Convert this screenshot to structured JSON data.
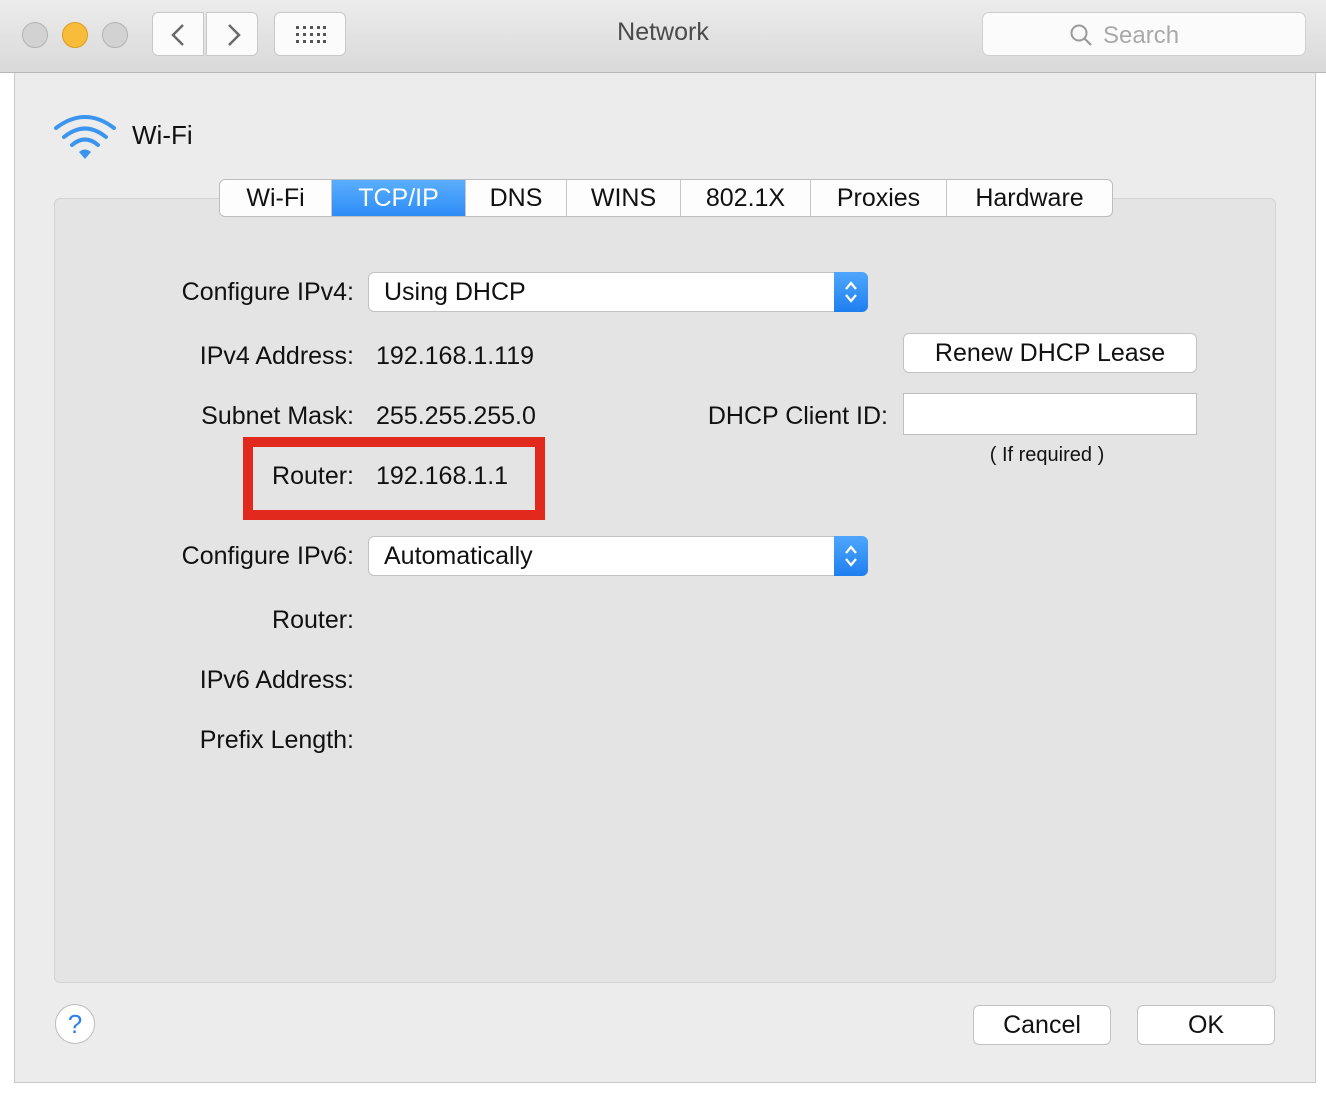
{
  "window": {
    "title": "Network",
    "search_placeholder": "Search"
  },
  "service": {
    "name": "Wi-Fi",
    "icon": "wifi-icon"
  },
  "tabs": [
    {
      "label": "Wi-Fi",
      "active": false
    },
    {
      "label": "TCP/IP",
      "active": true
    },
    {
      "label": "DNS",
      "active": false
    },
    {
      "label": "WINS",
      "active": false
    },
    {
      "label": "802.1X",
      "active": false
    },
    {
      "label": "Proxies",
      "active": false
    },
    {
      "label": "Hardware",
      "active": false
    }
  ],
  "ipv4": {
    "configure_label": "Configure IPv4:",
    "configure_value": "Using DHCP",
    "address_label": "IPv4 Address:",
    "address_value": "192.168.1.119",
    "subnet_label": "Subnet Mask:",
    "subnet_value": "255.255.255.0",
    "router_label": "Router:",
    "router_value": "192.168.1.1"
  },
  "dhcp": {
    "renew_label": "Renew DHCP Lease",
    "client_id_label": "DHCP Client ID:",
    "client_id_value": "",
    "client_id_hint": "( If required )"
  },
  "ipv6": {
    "configure_label": "Configure IPv6:",
    "configure_value": "Automatically",
    "router_label": "Router:",
    "address_label": "IPv6 Address:",
    "prefix_label": "Prefix Length:"
  },
  "footer": {
    "help_label": "?",
    "cancel_label": "Cancel",
    "ok_label": "OK"
  },
  "colors": {
    "accent": "#2d8cf6",
    "highlight": "#e12a1d",
    "close": "#d2d2d2",
    "minimize": "#f7bd3a"
  }
}
